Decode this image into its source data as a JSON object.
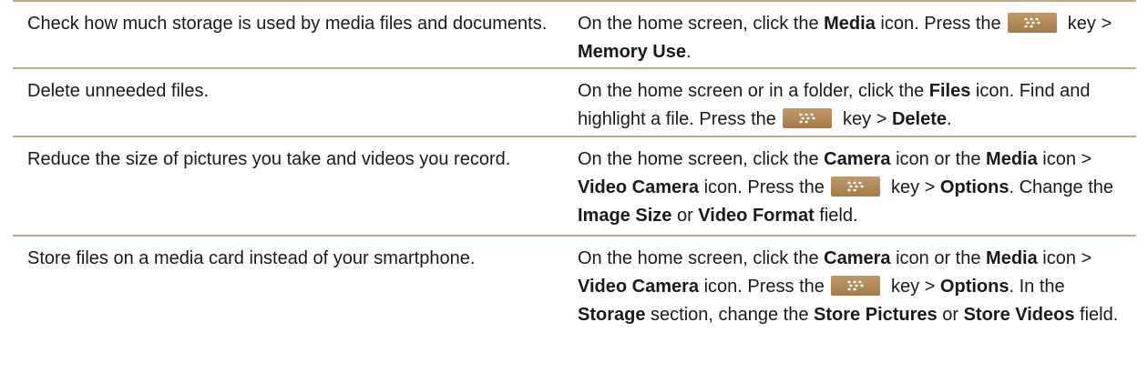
{
  "rows": [
    {
      "task": "Check how much storage is used by media files and documents.",
      "steps": [
        {
          "t": "On the home screen, click the "
        },
        {
          "t": "Media",
          "b": true
        },
        {
          "t": " icon. Press the "
        },
        {
          "key": "menu-key"
        },
        {
          "t": " key > "
        },
        {
          "t": "Memory Use",
          "b": true
        },
        {
          "t": "."
        }
      ]
    },
    {
      "task": "Delete unneeded files.",
      "steps": [
        {
          "t": "On the home screen or in a folder, click the "
        },
        {
          "t": "Files",
          "b": true
        },
        {
          "t": " icon. Find and highlight a file. Press the "
        },
        {
          "key": "menu-key"
        },
        {
          "t": " key > "
        },
        {
          "t": "Delete",
          "b": true
        },
        {
          "t": "."
        }
      ]
    },
    {
      "task": "Reduce the size of pictures you take and videos you record.",
      "steps": [
        {
          "t": "On the home screen, click the "
        },
        {
          "t": "Camera",
          "b": true
        },
        {
          "t": " icon or the "
        },
        {
          "t": "Media",
          "b": true
        },
        {
          "t": " icon > "
        },
        {
          "t": "Video Camera",
          "b": true
        },
        {
          "t": " icon. Press the "
        },
        {
          "key": "menu-key"
        },
        {
          "t": " key > "
        },
        {
          "t": "Options",
          "b": true
        },
        {
          "t": ". Change the "
        },
        {
          "t": "Image Size",
          "b": true
        },
        {
          "t": " or "
        },
        {
          "t": "Video Format",
          "b": true
        },
        {
          "t": " field."
        }
      ]
    },
    {
      "task": "Store files on a media card instead of your smartphone.",
      "steps": [
        {
          "t": "On the home screen, click the "
        },
        {
          "t": "Camera",
          "b": true
        },
        {
          "t": " icon or the "
        },
        {
          "t": "Media",
          "b": true
        },
        {
          "t": " icon > "
        },
        {
          "t": "Video Camera",
          "b": true
        },
        {
          "t": " icon. Press the "
        },
        {
          "key": "menu-key"
        },
        {
          "t": " key > "
        },
        {
          "t": "Options",
          "b": true
        },
        {
          "t": ". In the "
        },
        {
          "t": "Storage",
          "b": true
        },
        {
          "t": " section, change the "
        },
        {
          "t": "Store Pictures",
          "b": true
        },
        {
          "t": " or "
        },
        {
          "t": "Store Videos",
          "b": true
        },
        {
          "t": " field."
        }
      ]
    }
  ],
  "colors": {
    "rule": "#c0a880",
    "key": "#b08a58",
    "text": "#1a1a1a"
  }
}
